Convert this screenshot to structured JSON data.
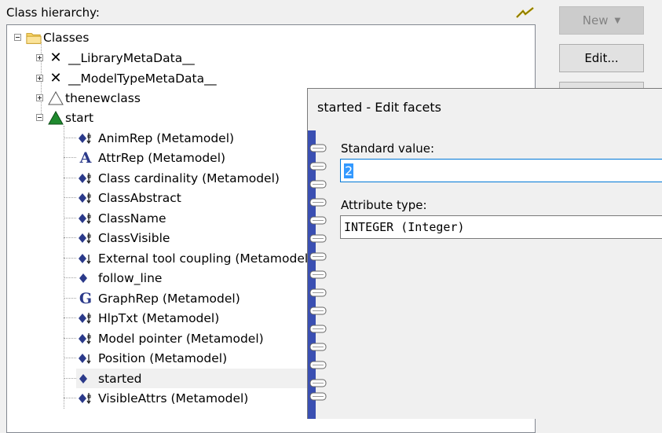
{
  "panel": {
    "title": "Class hierarchy:"
  },
  "buttons": {
    "new_label": "New",
    "edit_label": "Edit..."
  },
  "tree": {
    "root": "Classes",
    "classes": [
      "__LibraryMetaData__",
      "__ModelTypeMetaData__",
      "thenewclass",
      "start"
    ],
    "attributes": [
      {
        "label": "AnimRep (Metamodel)",
        "icon": "attribute-link-icon"
      },
      {
        "label": "AttrRep (Metamodel)",
        "icon": "letter-a-icon"
      },
      {
        "label": "Class cardinality (Metamodel)",
        "icon": "attribute-link-icon"
      },
      {
        "label": "ClassAbstract",
        "icon": "attribute-link-icon"
      },
      {
        "label": "ClassName",
        "icon": "attribute-link-icon"
      },
      {
        "label": "ClassVisible",
        "icon": "attribute-link-icon"
      },
      {
        "label": "External tool coupling (Metamodel)",
        "icon": "attribute-arrow-icon"
      },
      {
        "label": "follow_line",
        "icon": "diamond-icon"
      },
      {
        "label": "GraphRep (Metamodel)",
        "icon": "letter-g-icon"
      },
      {
        "label": "HlpTxt (Metamodel)",
        "icon": "attribute-link-icon"
      },
      {
        "label": "Model pointer (Metamodel)",
        "icon": "attribute-link-icon"
      },
      {
        "label": "Position (Metamodel)",
        "icon": "attribute-arrow-icon"
      },
      {
        "label": "started",
        "icon": "diamond-icon"
      },
      {
        "label": "VisibleAttrs (Metamodel)",
        "icon": "attribute-link-icon"
      }
    ]
  },
  "dialog": {
    "title": "started - Edit facets",
    "standard_value_label": "Standard value:",
    "standard_value": "2",
    "attribute_type_label": "Attribute type:",
    "attribute_type": "INTEGER (Integer)"
  },
  "colors": {
    "spine": "#3a4fb2",
    "selection": "#3399ff",
    "start_icon": "#1f8a2e"
  }
}
